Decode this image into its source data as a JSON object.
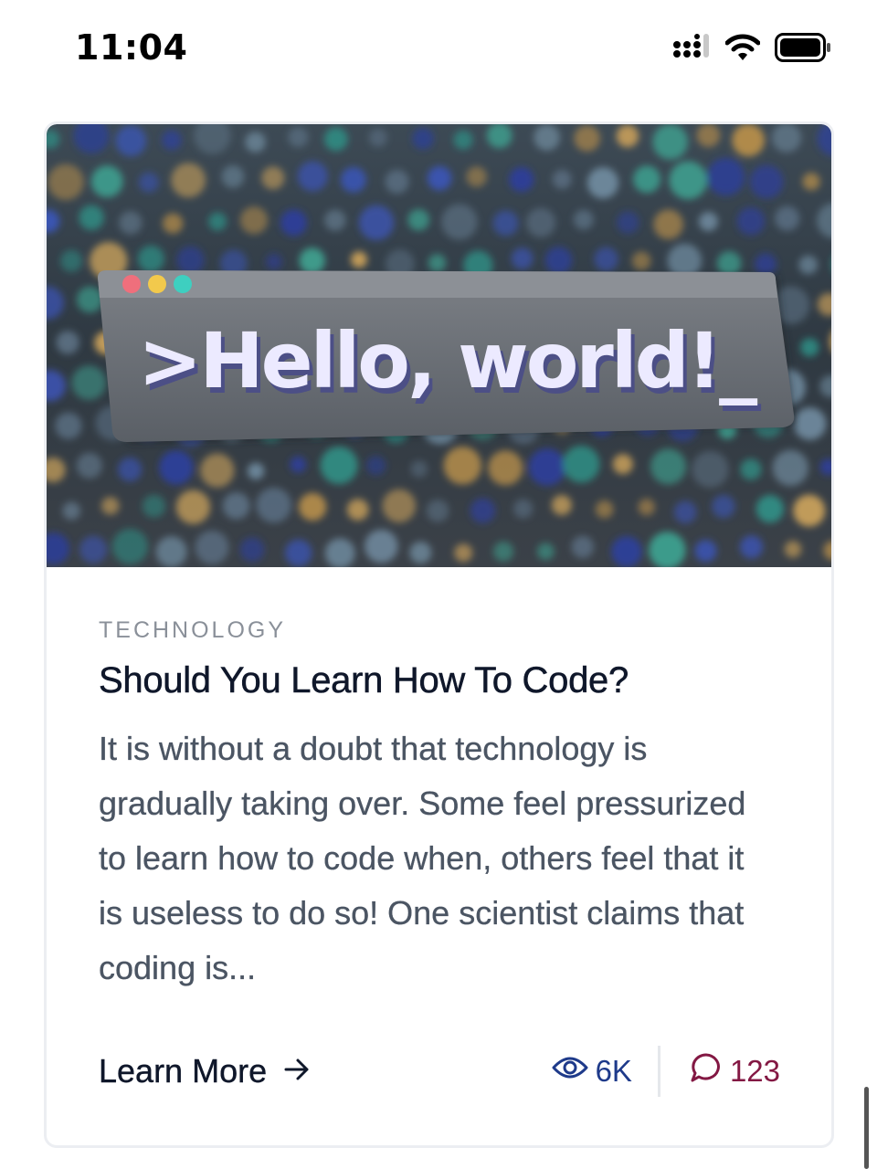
{
  "status_bar": {
    "time": "11:04",
    "icons": [
      "signal-icon",
      "wifi-icon",
      "battery-icon"
    ]
  },
  "card": {
    "image": {
      "alt_text": ">Hello, world!_",
      "window_dots": [
        "#ef6f7c",
        "#f2c94c",
        "#3ecfc0"
      ]
    },
    "category": "TECHNOLOGY",
    "title": "Should You Learn How To Code?",
    "excerpt": "It is without a doubt that technology is gradually taking over. Some feel pressurized to learn how to code when, others feel that it is useless to do so! One scientist claims that coding is...",
    "learn_more_label": "Learn More",
    "views": "6K",
    "comments": "123"
  },
  "colors": {
    "views": "#1e3a8a",
    "comments": "#831843",
    "category": "#8a9099",
    "body_text": "#4b5563"
  }
}
